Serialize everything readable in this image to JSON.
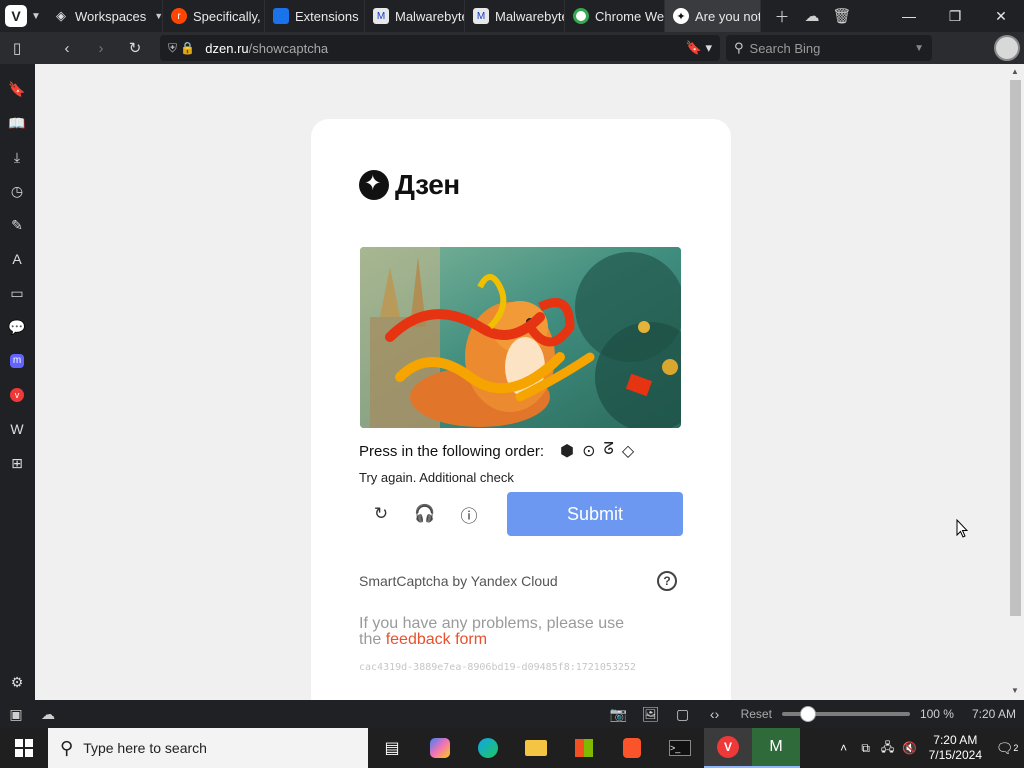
{
  "browser": {
    "tabs": [
      {
        "label": "Workspaces",
        "type": "workspaces"
      },
      {
        "label": "Specifically, v",
        "favicon": "reddit-icon",
        "color": "#ff4500"
      },
      {
        "label": "Extensions",
        "favicon": "extensions-icon",
        "color": "#1a73e8"
      },
      {
        "label": "Malwarebyte",
        "favicon": "malwarebytes-icon",
        "color": "#0d3ec9"
      },
      {
        "label": "Malwarebyte",
        "favicon": "malwarebytes-icon",
        "color": "#0d3ec9"
      },
      {
        "label": "Chrome Wel",
        "favicon": "chrome-icon",
        "color": "#34a853"
      },
      {
        "label": "Are you not a",
        "favicon": "dzen-icon",
        "color": "#111111",
        "active": true
      }
    ],
    "url_host": "dzen.ru",
    "url_path": "/showcaptcha",
    "search_placeholder": "Search Bing"
  },
  "page": {
    "brand": "Дзен",
    "instruction": "Press in the following order:",
    "order_symbols": [
      "⬢",
      "⊙",
      "ᘔ",
      "◇"
    ],
    "retry_message": "Try again. Additional check",
    "submit_label": "Submit",
    "provider": "SmartCaptcha by Yandex Cloud",
    "help_symbol": "?",
    "problems_text": "If you have any problems, please use the",
    "feedback_link": "feedback form",
    "request_id": "cac4319d-3889e7ea-8906bd19-d09485f8:1721053252"
  },
  "statusbar": {
    "reset_label": "Reset",
    "zoom": "100 %",
    "time": "7:20 AM"
  },
  "taskbar": {
    "search_placeholder": "Type here to search",
    "clock_time": "7:20 AM",
    "clock_date": "7/15/2024",
    "notification_count": "2"
  },
  "colors": {
    "submit": "#6d98f2",
    "link": "#e8502e",
    "browser_chrome": "#202124"
  }
}
